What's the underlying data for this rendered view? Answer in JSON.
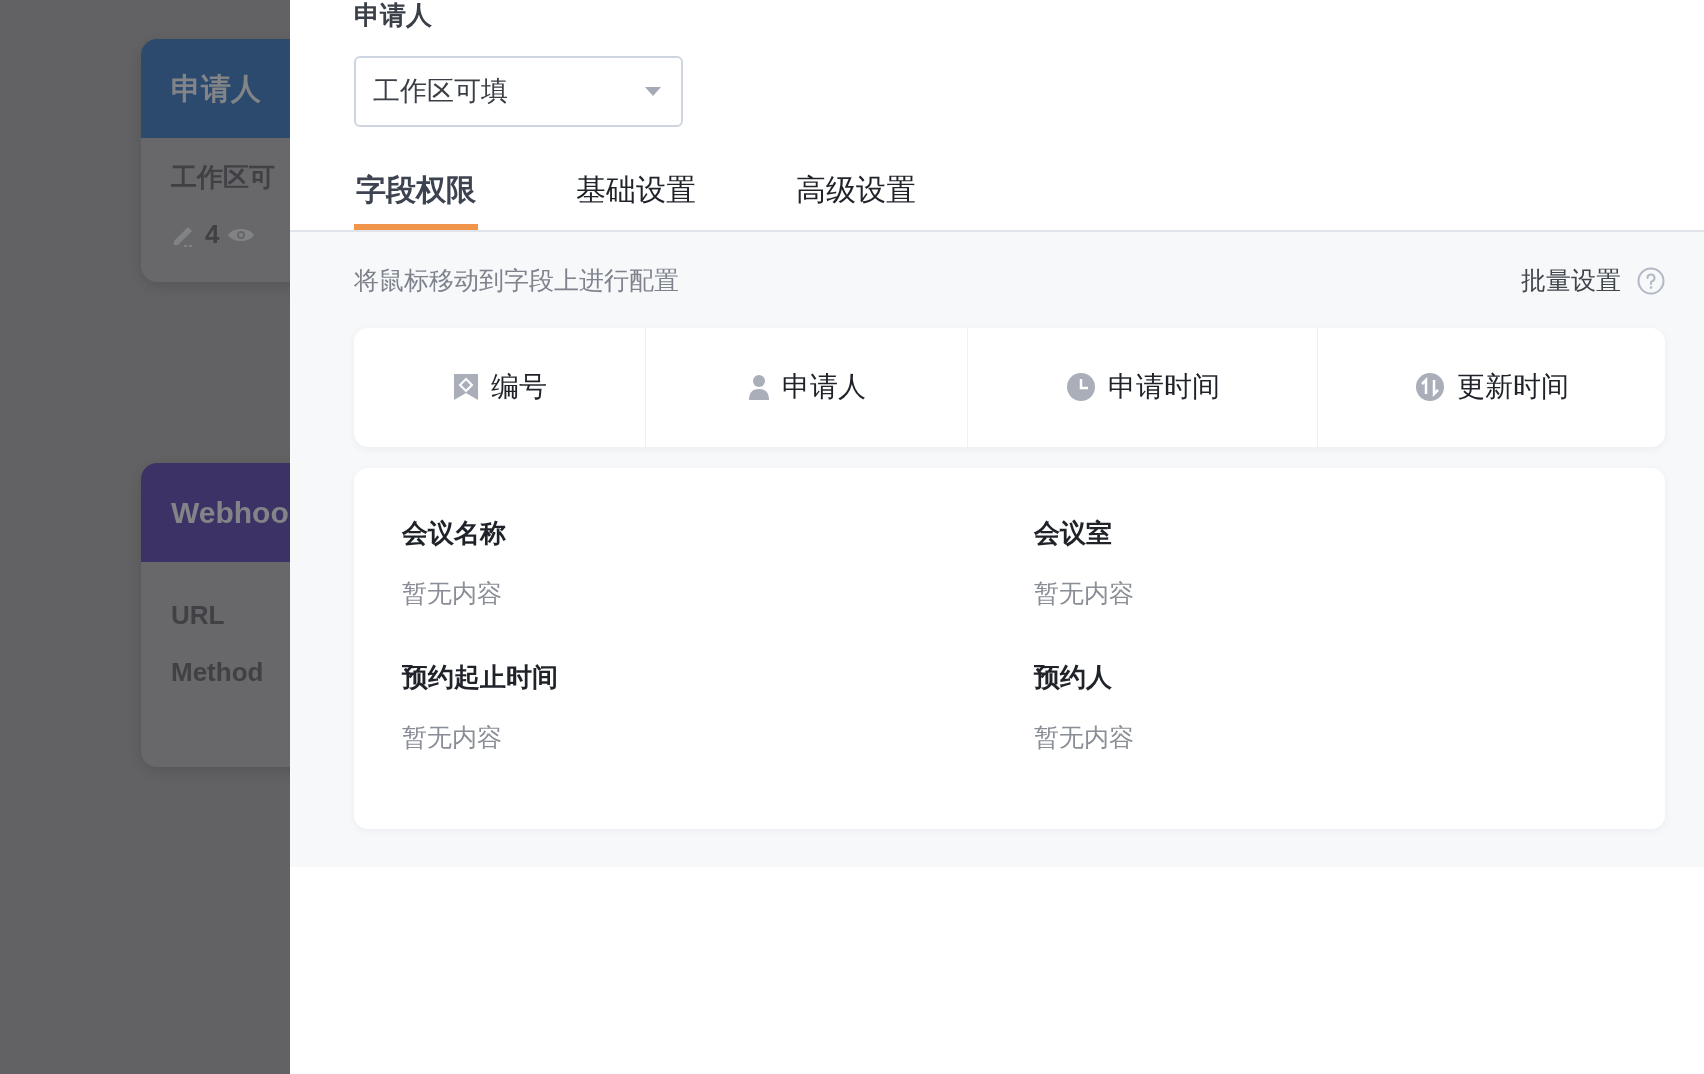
{
  "background_cards": [
    {
      "kind": "permission",
      "title": "申请人",
      "value": "工作区可",
      "edit_count": "4"
    },
    {
      "kind": "webhook",
      "title": "Webhoo",
      "rows": [
        "URL",
        "Method"
      ]
    }
  ],
  "drawer": {
    "field_label": "申请人",
    "select": {
      "value": "工作区可填"
    },
    "tabs": [
      {
        "label": "字段权限",
        "selected": true
      },
      {
        "label": "基础设置",
        "selected": false
      },
      {
        "label": "高级设置",
        "selected": false
      }
    ],
    "hint": "将鼠标移动到字段上进行配置",
    "batch_button": "批量设置",
    "system_fields": [
      {
        "kind": "serial",
        "label": "编号"
      },
      {
        "kind": "user",
        "label": "申请人"
      },
      {
        "kind": "created",
        "label": "申请时间"
      },
      {
        "kind": "updated",
        "label": "更新时间"
      }
    ],
    "form_fields": [
      {
        "label": "会议名称",
        "value": "暂无内容"
      },
      {
        "label": "会议室",
        "value": "暂无内容"
      },
      {
        "label": "预约起止时间",
        "value": "暂无内容"
      },
      {
        "label": "预约人",
        "value": "暂无内容"
      }
    ]
  }
}
